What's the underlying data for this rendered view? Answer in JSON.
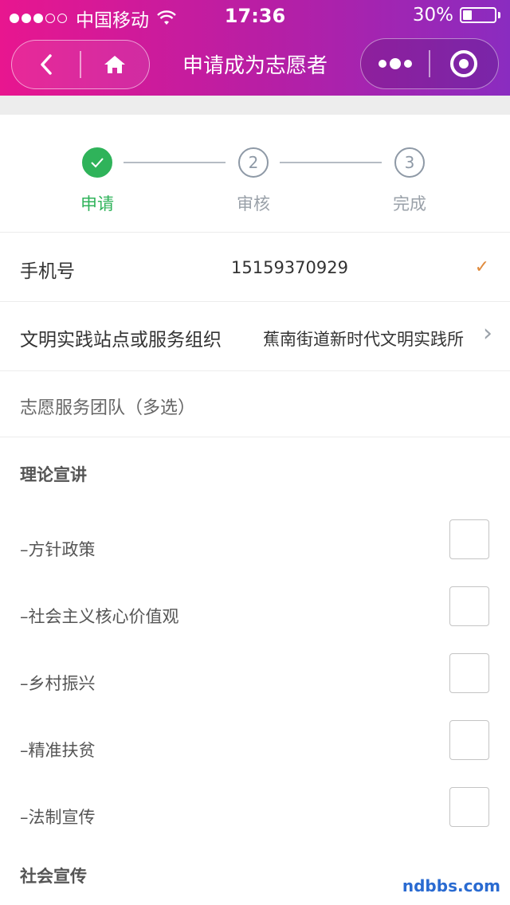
{
  "status_bar": {
    "carrier": "中国移动",
    "time": "17:36",
    "battery_text": "30%",
    "battery_level": 0.3
  },
  "nav": {
    "title": "申请成为志愿者",
    "back_icon": "back-chevron-icon",
    "home_icon": "home-icon",
    "more_icon": "more-dots-icon",
    "close_icon": "target-close-icon"
  },
  "steps": [
    {
      "num": "",
      "label": "申请",
      "state": "done"
    },
    {
      "num": "2",
      "label": "审核",
      "state": "pending"
    },
    {
      "num": "3",
      "label": "完成",
      "state": "pending"
    }
  ],
  "form": {
    "phone_label": "手机号",
    "phone_value": "15159370929",
    "phone_check": "✓",
    "org_label": "文明实践站点或服务组织",
    "org_value": "蕉南街道新时代文明实践所",
    "team_label": "志愿服务团队（多选）"
  },
  "groups": [
    {
      "title": "理论宣讲",
      "options": [
        "–方针政策",
        "–社会主义核心价值观",
        "–乡村振兴",
        "–精准扶贫",
        "–法制宣传"
      ]
    },
    {
      "title": "社会宣传",
      "options": []
    }
  ],
  "colors": {
    "accent_green": "#2fb35a",
    "header_start": "#e8168f",
    "header_end": "#8a2cc0",
    "check_orange": "#e08a3c"
  },
  "watermark": "ndbbs.com"
}
